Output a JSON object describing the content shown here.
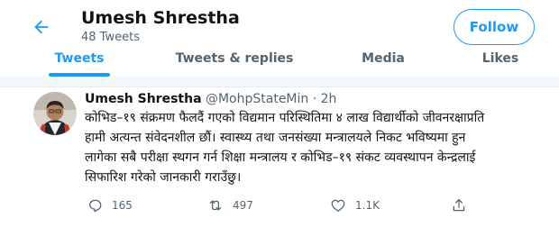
{
  "header": {
    "back_icon": "arrow-left-icon",
    "title": "Umesh Shrestha",
    "subtitle": "48 Tweets",
    "follow_label": "Follow"
  },
  "tabs": [
    {
      "label": "Tweets",
      "active": true
    },
    {
      "label": "Tweets & replies",
      "active": false
    },
    {
      "label": "Media",
      "active": false
    },
    {
      "label": "Likes",
      "active": false
    }
  ],
  "tweet": {
    "name": "Umesh Shrestha",
    "handle": "@MohpStateMin",
    "separator": "·",
    "time": "2h",
    "lines": [
      "कोभिड–१९ संक्रमण फैलदैं गएको विद्यमान परिस्थितिमा ४ लाख विद्यार्थीको जीवनरक्षाप्रति",
      "हामी अत्यन्त संवेदनशील छौं। स्वास्थ्य तथा जनसंख्या मन्त्रालयले निकट भविष्यमा हुन",
      "लागेका सबै परीक्षा स्थगन गर्न शिक्षा मन्त्रालय र कोभिड–१९ संकट व्यवस्थापन केन्द्रलाई",
      "सिफारिश गरेको जानकारी गराउँछु।"
    ],
    "actions": {
      "reply": {
        "icon": "reply-icon",
        "count": "165"
      },
      "retweet": {
        "icon": "retweet-icon",
        "count": "497"
      },
      "like": {
        "icon": "heart-icon",
        "count": "1.1K"
      },
      "share": {
        "icon": "share-icon"
      }
    }
  },
  "colors": {
    "accent": "#1d9bf0",
    "text": "#0f1419",
    "secondary": "#536471",
    "band": "#f5f8fa"
  }
}
